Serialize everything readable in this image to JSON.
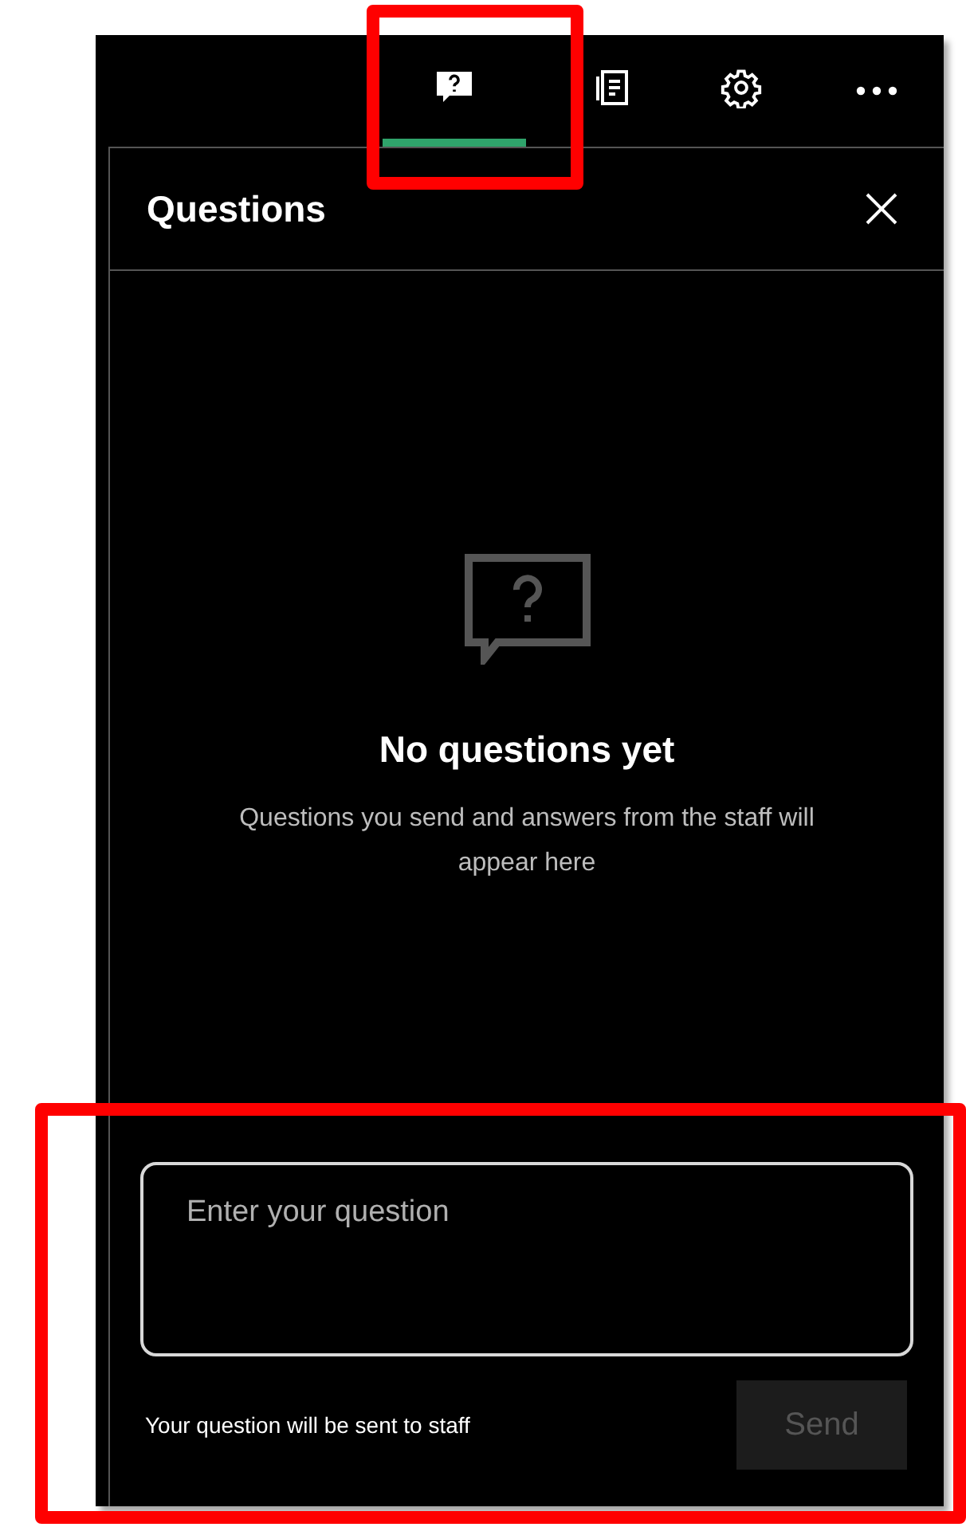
{
  "toolbar": {
    "tabs": [
      {
        "kind": "questions",
        "selected": true
      },
      {
        "kind": "notes",
        "selected": false
      },
      {
        "kind": "settings",
        "selected": false
      }
    ]
  },
  "panel": {
    "title": "Questions",
    "empty_state": {
      "title": "No questions yet",
      "description": "Questions you send and answers from the staff will appear here"
    },
    "question_input": {
      "placeholder": "Enter your question"
    },
    "hint": "Your question will be sent to staff",
    "send_button": {
      "label": "Send",
      "disabled": true
    }
  }
}
